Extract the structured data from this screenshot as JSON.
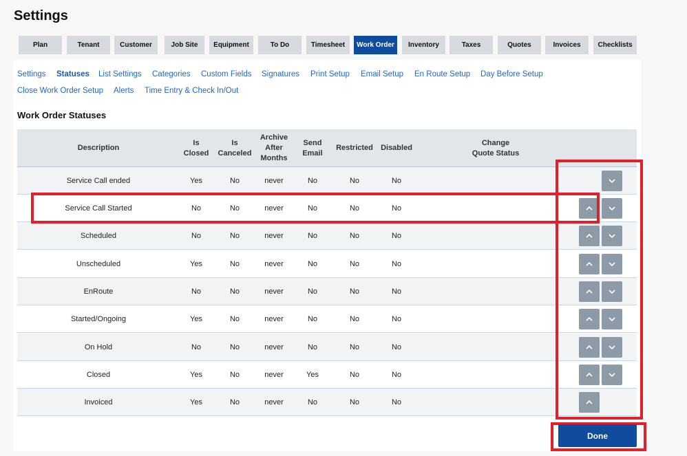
{
  "page": {
    "title": "Settings"
  },
  "tabs": [
    {
      "label": "Plan",
      "active": false
    },
    {
      "label": "Tenant",
      "active": false
    },
    {
      "label": "Customer",
      "active": false
    },
    {
      "label": "Job Site",
      "active": false
    },
    {
      "label": "Equipment",
      "active": false
    },
    {
      "label": "To Do",
      "active": false
    },
    {
      "label": "Timesheet",
      "active": false
    },
    {
      "label": "Work Order",
      "active": true
    },
    {
      "label": "Inventory",
      "active": false
    },
    {
      "label": "Taxes",
      "active": false
    },
    {
      "label": "Quotes",
      "active": false
    },
    {
      "label": "Invoices",
      "active": false
    },
    {
      "label": "Checklists",
      "active": false
    }
  ],
  "sublinks": [
    {
      "label": "Settings",
      "active": false
    },
    {
      "label": "Statuses",
      "active": true
    },
    {
      "label": "List Settings",
      "active": false
    },
    {
      "label": "Categories",
      "active": false
    },
    {
      "label": "Custom Fields",
      "active": false
    },
    {
      "label": "Signatures",
      "active": false
    },
    {
      "label": "Print Setup",
      "active": false
    },
    {
      "label": "Email Setup",
      "active": false
    },
    {
      "label": "En Route Setup",
      "active": false
    },
    {
      "label": "Day Before Setup",
      "active": false
    },
    {
      "label": "Close Work Order Setup",
      "active": false
    },
    {
      "label": "Alerts",
      "active": false
    },
    {
      "label": "Time Entry & Check In/Out",
      "active": false
    }
  ],
  "section_title": "Work Order Statuses",
  "table": {
    "headers": {
      "description": "Description",
      "is_closed": "Is\nClosed",
      "is_canceled": "Is\nCanceled",
      "archive": "Archive\nAfter\nMonths",
      "send_email": "Send\nEmail",
      "restricted": "Restricted",
      "disabled": "Disabled",
      "change_quote": "Change\nQuote Status"
    },
    "rows": [
      {
        "description": "Service Call ended",
        "is_closed": "Yes",
        "is_canceled": "No",
        "archive": "never",
        "send_email": "No",
        "restricted": "No",
        "disabled": "No",
        "up": false,
        "down": true
      },
      {
        "description": "Service Call Started",
        "is_closed": "No",
        "is_canceled": "No",
        "archive": "never",
        "send_email": "No",
        "restricted": "No",
        "disabled": "No",
        "up": true,
        "down": true
      },
      {
        "description": "Scheduled",
        "is_closed": "No",
        "is_canceled": "No",
        "archive": "never",
        "send_email": "No",
        "restricted": "No",
        "disabled": "No",
        "up": true,
        "down": true
      },
      {
        "description": "Unscheduled",
        "is_closed": "Yes",
        "is_canceled": "No",
        "archive": "never",
        "send_email": "No",
        "restricted": "No",
        "disabled": "No",
        "up": true,
        "down": true
      },
      {
        "description": "EnRoute",
        "is_closed": "No",
        "is_canceled": "No",
        "archive": "never",
        "send_email": "No",
        "restricted": "No",
        "disabled": "No",
        "up": true,
        "down": true
      },
      {
        "description": "Started/Ongoing",
        "is_closed": "Yes",
        "is_canceled": "No",
        "archive": "never",
        "send_email": "No",
        "restricted": "No",
        "disabled": "No",
        "up": true,
        "down": true
      },
      {
        "description": "On Hold",
        "is_closed": "No",
        "is_canceled": "No",
        "archive": "never",
        "send_email": "No",
        "restricted": "No",
        "disabled": "No",
        "up": true,
        "down": true
      },
      {
        "description": "Closed",
        "is_closed": "Yes",
        "is_canceled": "No",
        "archive": "never",
        "send_email": "Yes",
        "restricted": "No",
        "disabled": "No",
        "up": true,
        "down": true
      },
      {
        "description": "Invoiced",
        "is_closed": "Yes",
        "is_canceled": "No",
        "archive": "never",
        "send_email": "No",
        "restricted": "No",
        "disabled": "No",
        "up": true,
        "down": false
      }
    ]
  },
  "done_label": "Done",
  "colors": {
    "accent": "#0f4c9e",
    "highlight": "#e0202b",
    "arrow_button": "#8c9ba5"
  },
  "icons": {
    "up": "chevron-up-icon",
    "down": "chevron-down-icon"
  }
}
